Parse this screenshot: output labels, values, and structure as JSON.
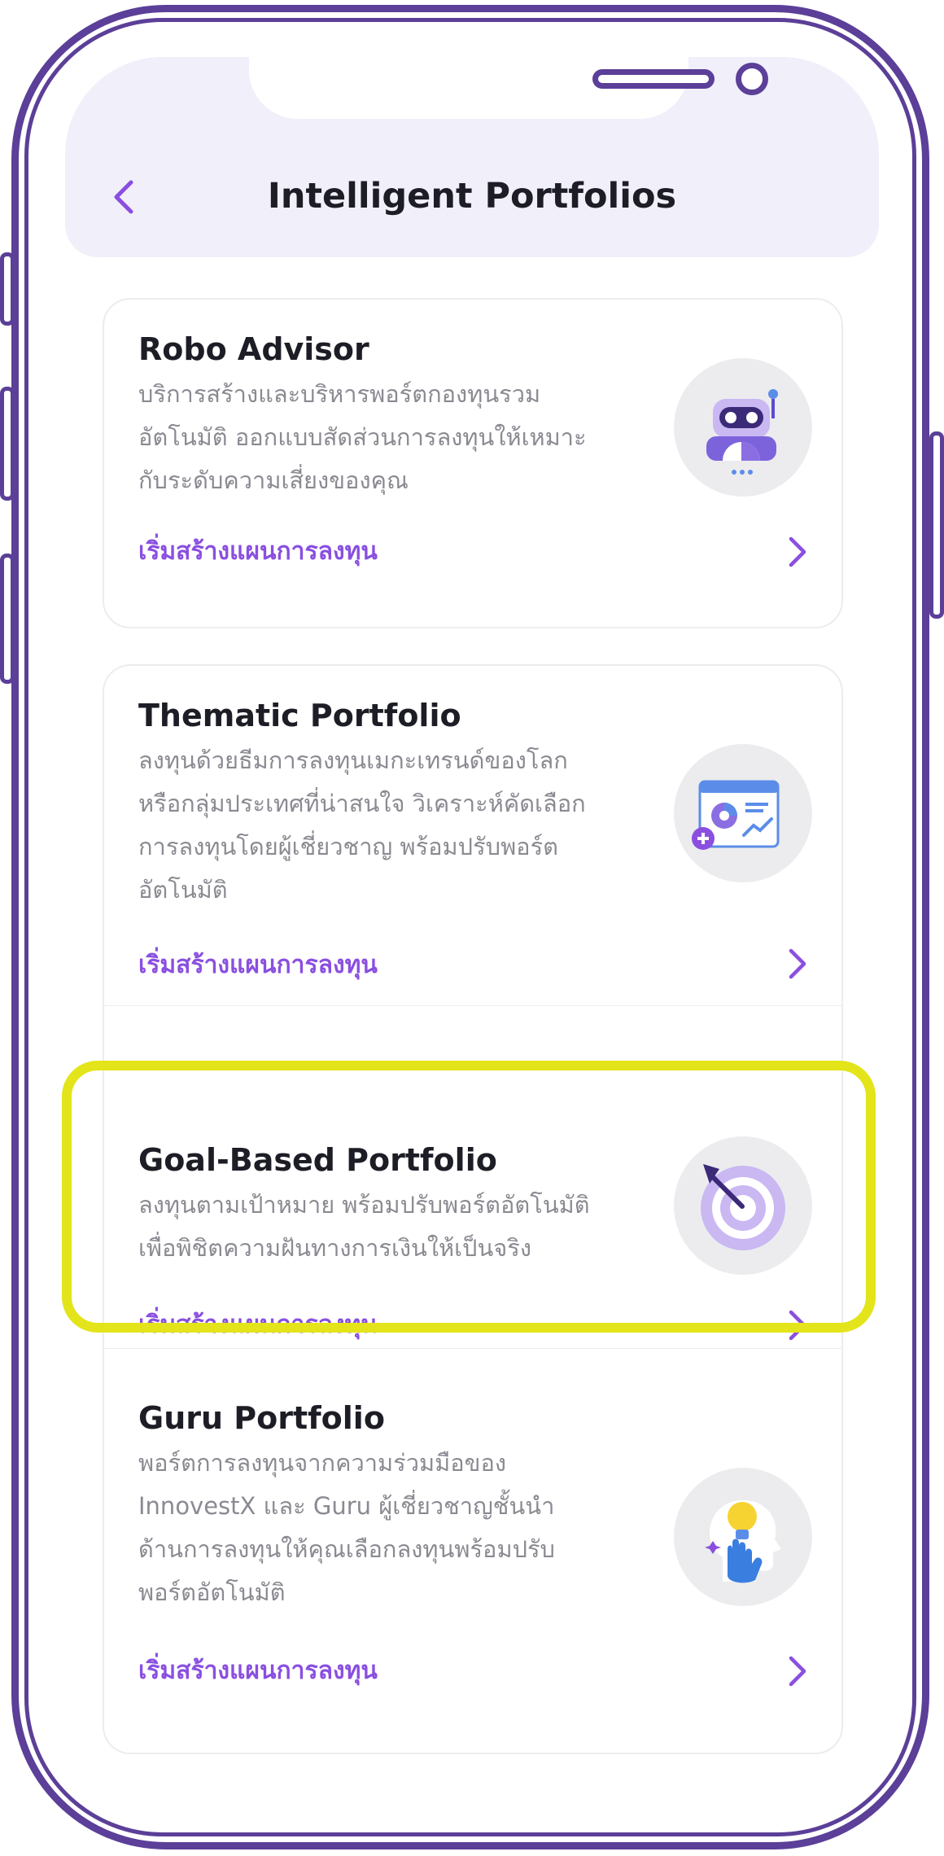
{
  "header": {
    "title": "Intelligent Portfolios",
    "back_icon": "chevron-left-icon"
  },
  "colors": {
    "accent": "#8a4fe0",
    "frame": "#5b3f98",
    "highlight": "#e3e41a",
    "header_bg": "#f1effa"
  },
  "cards": [
    {
      "title": "Robo Advisor",
      "desc": [
        "บริการสร้างและบริหารพอร์ตกองทุนรวม",
        "อัตโนมัติ ออกแบบสัดส่วนการลงทุนให้เหมาะ",
        "กับระดับความเสี่ยงของคุณ"
      ],
      "cta": "เริ่มสร้างแผนการลงทุน",
      "icon": "robot-icon"
    },
    {
      "title": "Thematic Portfolio",
      "desc": [
        "ลงทุนด้วยธีมการลงทุนเมกะเทรนด์ของโลก",
        "หรือกลุ่มประเทศที่น่าสนใจ วิเคราะห์คัดเลือก",
        "การลงทุนโดยผู้เชี่ยวชาญ พร้อมปรับพอร์ต",
        "อัตโนมัติ"
      ],
      "cta": "เริ่มสร้างแผนการลงทุน",
      "icon": "chart-dashboard-icon"
    },
    {
      "title": "Goal-Based Portfolio",
      "desc": [
        "ลงทุนตามเป้าหมาย พร้อมปรับพอร์ตอัตโนมัติ",
        "เพื่อพิชิตความฝันทางการเงินให้เป็นจริง"
      ],
      "cta": "เริ่มสร้างแผนการลงทุน",
      "icon": "target-arrow-icon"
    },
    {
      "title": "Guru Portfolio",
      "desc": [
        "พอร์ตการลงทุนจากความร่วมมือของ",
        "InnovestX และ Guru ผู้เชี่ยวชาญชั้นนำ",
        "ด้านการลงทุนให้คุณเลือกลงทุนพร้อมปรับ",
        "พอร์ตอัตโนมัติ"
      ],
      "cta": "เริ่มสร้างแผนการลงทุน",
      "icon": "idea-head-icon"
    }
  ]
}
